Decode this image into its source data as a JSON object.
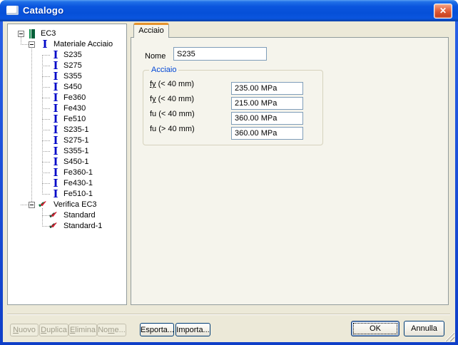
{
  "window": {
    "title": "Catalogo",
    "close_glyph": "✕"
  },
  "icons": {
    "ibeam_glyph": "I",
    "check_glyph": "✔"
  },
  "colors": {
    "titlebar_blue": "#0A55DE",
    "window_border_blue": "#0F3FC8",
    "dialog_bg": "#ECE9D8",
    "tab_page_bg": "#F5F4EC",
    "active_tab_accent": "#E5932C",
    "group_label_blue": "#0046D5",
    "input_border": "#7F9DB9",
    "ibeam_blue": "#0008C8",
    "check_red": "#CE1B2E",
    "check_green": "#0B6E38",
    "close_red": "#D8542F"
  },
  "tree": {
    "items": [
      {
        "label": "EC3",
        "icon": "beam-green-icon",
        "depth": 0,
        "expander": "minus"
      },
      {
        "label": "Materiale Acciaio",
        "icon": "ibeam-blue-icon",
        "depth": 1,
        "expander": "minus"
      },
      {
        "label": "S235",
        "icon": "ibeam-blue-icon",
        "depth": 2
      },
      {
        "label": "S275",
        "icon": "ibeam-blue-icon",
        "depth": 2
      },
      {
        "label": "S355",
        "icon": "ibeam-blue-icon",
        "depth": 2
      },
      {
        "label": "S450",
        "icon": "ibeam-blue-icon",
        "depth": 2
      },
      {
        "label": "Fe360",
        "icon": "ibeam-blue-icon",
        "depth": 2
      },
      {
        "label": "Fe430",
        "icon": "ibeam-blue-icon",
        "depth": 2
      },
      {
        "label": "Fe510",
        "icon": "ibeam-blue-icon",
        "depth": 2
      },
      {
        "label": "S235-1",
        "icon": "ibeam-blue-icon",
        "depth": 2
      },
      {
        "label": "S275-1",
        "icon": "ibeam-blue-icon",
        "depth": 2
      },
      {
        "label": "S355-1",
        "icon": "ibeam-blue-icon",
        "depth": 2
      },
      {
        "label": "S450-1",
        "icon": "ibeam-blue-icon",
        "depth": 2
      },
      {
        "label": "Fe360-1",
        "icon": "ibeam-blue-icon",
        "depth": 2
      },
      {
        "label": "Fe430-1",
        "icon": "ibeam-blue-icon",
        "depth": 2
      },
      {
        "label": "Fe510-1",
        "icon": "ibeam-blue-icon",
        "depth": 2
      },
      {
        "label": "Verifica EC3",
        "icon": "check-green-red-icon",
        "depth": 1,
        "expander": "minus"
      },
      {
        "label": "Standard",
        "icon": "check-red-icon",
        "depth": 2
      },
      {
        "label": "Standard-1",
        "icon": "check-red-icon",
        "depth": 2
      }
    ]
  },
  "tab": {
    "label": "Acciaio"
  },
  "form": {
    "nome_label": "Nome",
    "nome_value": "S235",
    "group_label": "Acciaio",
    "rows": [
      {
        "sym": "fy",
        "rest": " (< 40 mm)",
        "value": "235.00 MPa"
      },
      {
        "sym_pre": "f",
        "sym_u": "y",
        "rest": " (< 40 mm)",
        "value": "215.00 MPa"
      },
      {
        "sym": "fu",
        "rest": " (< 40 mm)",
        "value": "360.00 MPa"
      },
      {
        "sym": "fu",
        "rest": " (> 40 mm)",
        "value": "360.00 MPa"
      }
    ]
  },
  "buttons": {
    "nuovo": {
      "key": "N",
      "rest": "uovo"
    },
    "duplica": {
      "key": "D",
      "rest": "uplica"
    },
    "elimina": {
      "key": "E",
      "rest": "limina"
    },
    "nome": {
      "pre": "No",
      "key": "m",
      "rest": "e..."
    },
    "esporta": "Esporta...",
    "importa": "Importa...",
    "ok": "OK",
    "annulla": "Annulla"
  }
}
